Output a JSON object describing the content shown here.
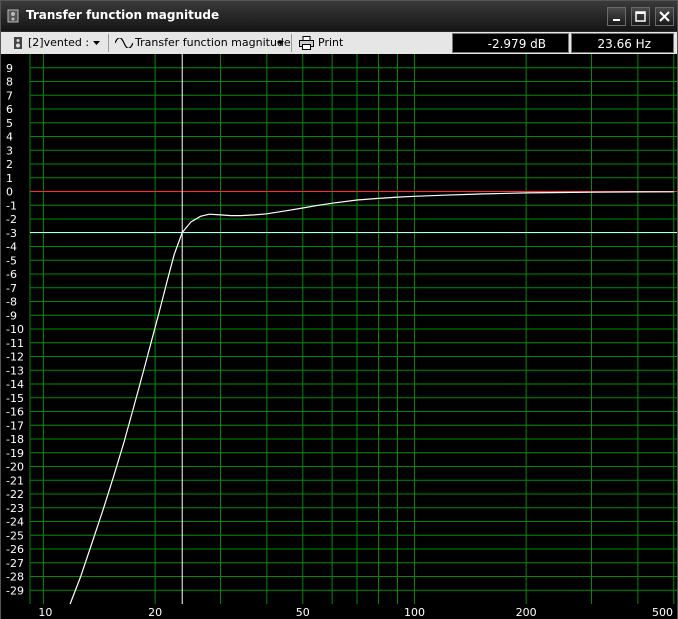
{
  "window": {
    "title": "Transfer function magnitude"
  },
  "toolbar": {
    "box_select": "[2]vented :",
    "view_select": "Transfer function magnitude",
    "print_label": "Print",
    "readout_db": "-2.979 dB",
    "readout_hz": "23.66 Hz"
  },
  "colors": {
    "background": "#000000",
    "grid": "#008c00",
    "curve": "#ffffff",
    "reference_line": "#ff2a2a",
    "cursor_line": "#b8fff0",
    "axis_text": "#ffffff"
  },
  "icons": {
    "title": "speaker-box-icon",
    "box_select": "speaker-box-icon",
    "view_select": "waveform-icon",
    "print": "printer-icon"
  },
  "chart_data": {
    "type": "line",
    "title": "",
    "xlabel": "",
    "ylabel": "",
    "xscale": "log",
    "xlim": [
      9.2,
      510
    ],
    "ylim": [
      -30,
      10
    ],
    "grid": true,
    "x_ticks": [
      10,
      20,
      50,
      100,
      200,
      500
    ],
    "y_ticks": [
      9,
      8,
      7,
      6,
      5,
      4,
      3,
      2,
      1,
      0,
      -1,
      -2,
      -3,
      -4,
      -5,
      -6,
      -7,
      -8,
      -9,
      -10,
      -11,
      -12,
      -13,
      -14,
      -15,
      -16,
      -17,
      -18,
      -19,
      -20,
      -21,
      -22,
      -23,
      -24,
      -25,
      -26,
      -27,
      -28,
      -29
    ],
    "reference_level": 0,
    "cursor": {
      "x": 23.66,
      "y": -2.979
    },
    "series": [
      {
        "x": [
          11.8,
          12.6,
          13.5,
          14.5,
          15.5,
          16.5,
          17.5,
          18.5,
          19.5,
          20.5,
          21.5,
          22.5,
          23.66,
          25,
          26.5,
          28,
          30,
          32,
          34,
          37,
          40,
          45,
          50,
          55,
          60,
          70,
          80,
          90,
          100,
          120,
          150,
          200,
          250,
          300,
          400,
          500
        ],
        "y": [
          -30,
          -28,
          -25.6,
          -23.1,
          -20.6,
          -18.2,
          -15.7,
          -13.3,
          -11.0,
          -8.8,
          -6.6,
          -4.6,
          -2.979,
          -2.2,
          -1.8,
          -1.65,
          -1.7,
          -1.75,
          -1.75,
          -1.7,
          -1.62,
          -1.4,
          -1.2,
          -1.0,
          -0.85,
          -0.62,
          -0.5,
          -0.41,
          -0.35,
          -0.27,
          -0.18,
          -0.1,
          -0.07,
          -0.05,
          -0.03,
          -0.02
        ]
      }
    ]
  }
}
